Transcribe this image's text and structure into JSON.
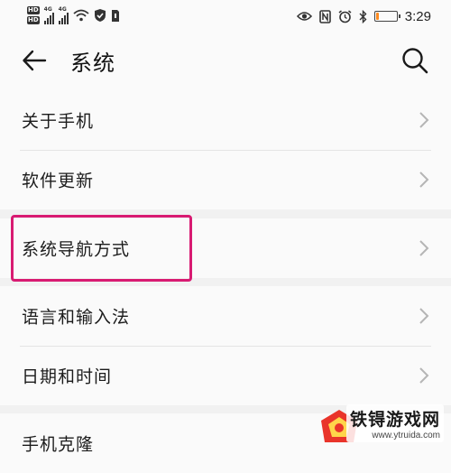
{
  "status_bar": {
    "hd_badges": [
      "HD",
      "HD"
    ],
    "net_labels": [
      "4G",
      "4G"
    ],
    "time": "3:29",
    "battery_level": 0.15,
    "battery_color": "#ff8a1f",
    "icons": [
      "wifi-icon",
      "shield-icon",
      "sim-icon",
      "eye-icon",
      "nfc-icon",
      "alarm-icon",
      "bluetooth-icon"
    ]
  },
  "title_bar": {
    "title": "系统",
    "back_icon": "arrow-left-icon",
    "search_icon": "search-icon"
  },
  "groups": [
    {
      "items": [
        {
          "label": "关于手机"
        },
        {
          "label": "软件更新"
        }
      ]
    },
    {
      "items": [
        {
          "label": "系统导航方式",
          "highlighted": true
        }
      ]
    },
    {
      "items": [
        {
          "label": "语言和输入法"
        },
        {
          "label": "日期和时间"
        }
      ]
    },
    {
      "items": [
        {
          "label": "手机克隆"
        }
      ]
    }
  ],
  "highlight_color": "#d81b72",
  "watermark": {
    "brand": "铁锝游戏网",
    "url": "www.ytruida.com"
  }
}
